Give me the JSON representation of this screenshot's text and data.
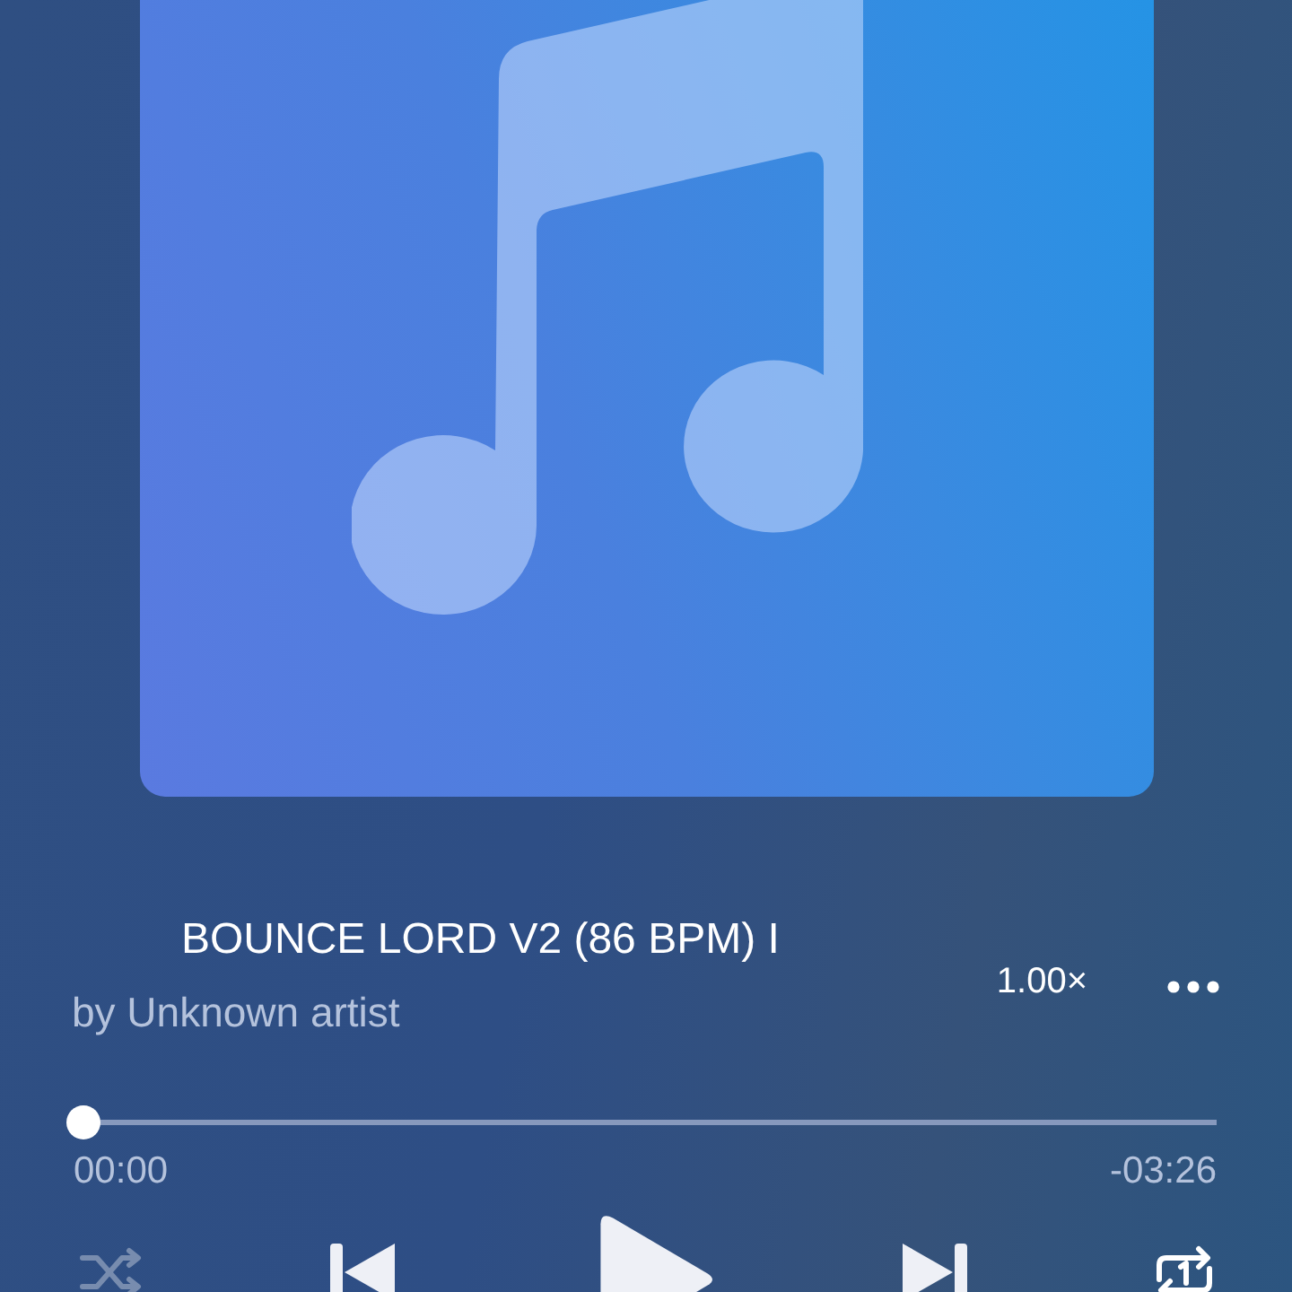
{
  "artwork": {
    "kind": "music-note"
  },
  "track": {
    "title": "BOUNCE LORD V2 (86 BPM) I",
    "artist": "by Unknown artist"
  },
  "speed": "1.00×",
  "progress": {
    "level": 0,
    "elapsed": "00:00",
    "remaining": "-03:26"
  },
  "controls": [
    {
      "kind": "shuffle",
      "on": false
    },
    {
      "kind": "previous"
    },
    {
      "kind": "play"
    },
    {
      "kind": "next"
    },
    {
      "kind": "repeat-one",
      "on": true
    }
  ]
}
